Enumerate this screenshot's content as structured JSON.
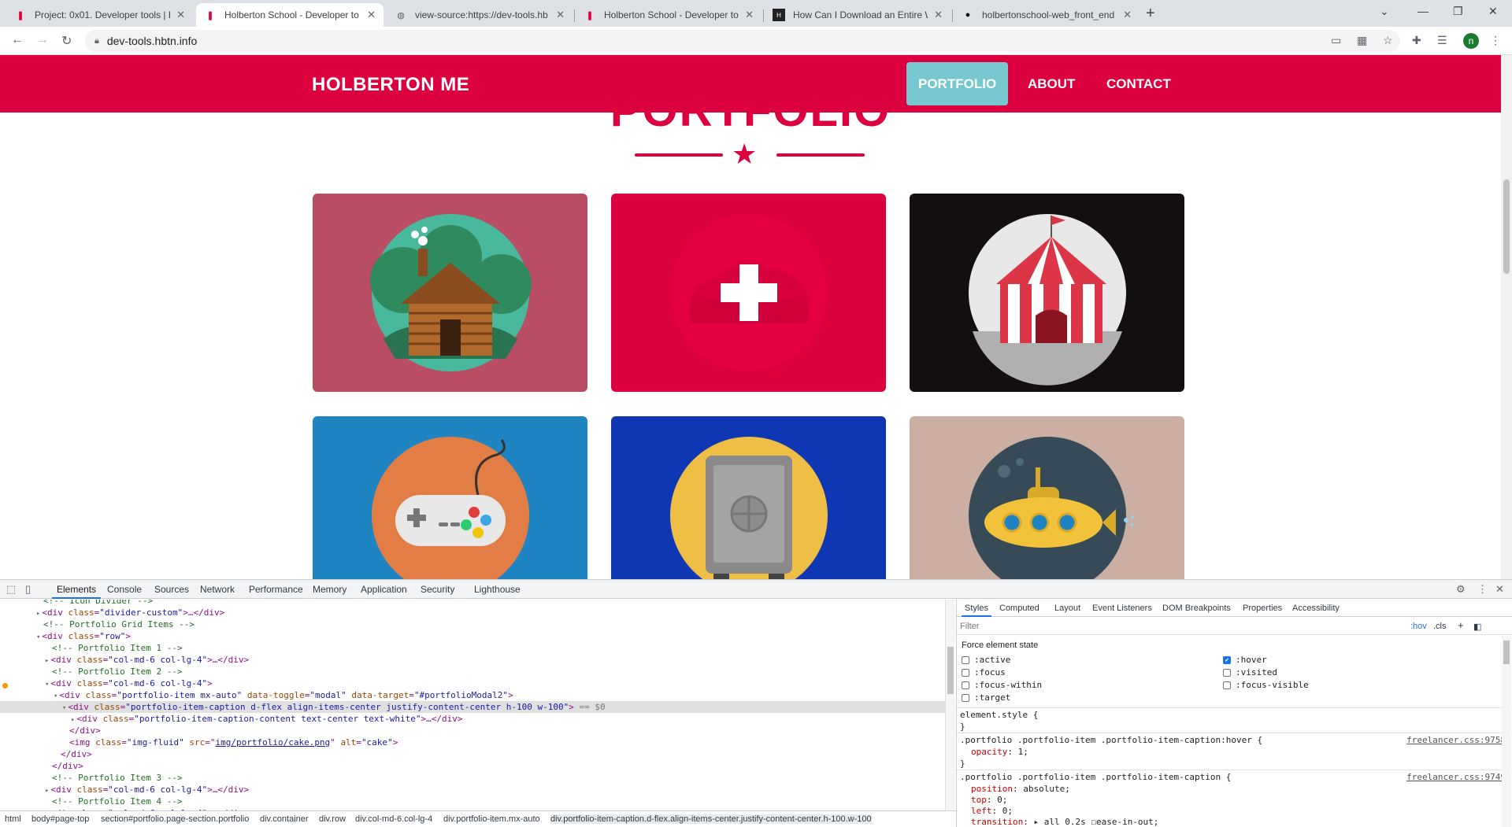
{
  "tabs": [
    {
      "title": "Project: 0x01. Developer tools | H",
      "favicon": "holberton-icon"
    },
    {
      "title": "Holberton School - Developer to",
      "favicon": "holberton-icon"
    },
    {
      "title": "view-source:https://dev-tools.hb",
      "favicon": "globe-icon"
    },
    {
      "title": "Holberton School - Developer to",
      "favicon": "holberton-icon"
    },
    {
      "title": "How Can I Download an Entire W",
      "favicon": "htg-icon"
    },
    {
      "title": "holbertonschool-web_front_end",
      "favicon": "github-icon"
    }
  ],
  "address": {
    "url": "dev-tools.hbtn.info"
  },
  "site": {
    "brand": "HOLBERTON ME",
    "nav": [
      "PORTFOLIO",
      "ABOUT",
      "CONTACT"
    ],
    "section_title": "PORTFOLIO",
    "portfolio_items": [
      {
        "name": "cabin",
        "bg": "#b84d63"
      },
      {
        "name": "cake",
        "bg": "#dc003f"
      },
      {
        "name": "circus",
        "bg": "#130f0f"
      },
      {
        "name": "game",
        "bg": "#1f84c2"
      },
      {
        "name": "safe",
        "bg": "#1037b3"
      },
      {
        "name": "submarine",
        "bg": "#ccaea3"
      }
    ]
  },
  "devtools": {
    "tabs": [
      "Elements",
      "Console",
      "Sources",
      "Network",
      "Performance",
      "Memory",
      "Application",
      "Security",
      "Lighthouse"
    ],
    "dom": {
      "l0": "<!-- Icon Divider -->",
      "l1_tag": "<div ",
      "l1_attr": "class",
      "l1_val": "\"divider-custom\"",
      "l1_end": ">…</div>",
      "l2": "<!-- Portfolio Grid Items -->",
      "l3_val": "\"row\"",
      "l4": "<!-- Portfolio Item 1 -->",
      "col_val": "\"col-md-6 col-lg-4\"",
      "l6": "<!-- Portfolio Item 2 -->",
      "l8_val": "\"portfolio-item mx-auto\"",
      "l8_a2": "data-toggle",
      "l8_v2": "\"modal\"",
      "l8_a3": "data-target",
      "l8_v3": "\"#portfolioModal2\"",
      "l9_val": "\"portfolio-item-caption d-flex align-items-center justify-content-center h-100 w-100\"",
      "l9_suffix": " == $0",
      "l10_val": "\"portfolio-item-caption-content text-center text-white\"",
      "close_div": "</div>",
      "img_cls": "\"img-fluid\"",
      "img_src": "img/portfolio/cake.png",
      "img_alt": "\"cake\"",
      "l15": "<!-- Portfolio Item 3 -->",
      "l17": "<!-- Portfolio Item 4 -->"
    },
    "breadcrumbs": [
      "html",
      "body#page-top",
      "section#portfolio.page-section.portfolio",
      "div.container",
      "div.row",
      "div.col-md-6.col-lg-4",
      "div.portfolio-item.mx-auto",
      "div.portfolio-item-caption.d-flex.align-items-center.justify-content-center.h-100.w-100"
    ],
    "styles": {
      "tabs": [
        "Styles",
        "Computed",
        "Layout",
        "Event Listeners",
        "DOM Breakpoints",
        "Properties",
        "Accessibility"
      ],
      "filter_placeholder": "Filter",
      "hov": ":hov",
      "cls": ".cls",
      "force_state_title": "Force element state",
      "states_left": [
        ":active",
        ":focus",
        ":focus-within",
        ":target"
      ],
      "states_right": [
        ":hover",
        ":visited",
        ":focus-visible"
      ],
      "checked_state": ":hover",
      "element_style": "element.style {",
      "close_brace": "}",
      "rule1_selector": ".portfolio .portfolio-item .portfolio-item-caption:hover {",
      "rule1_src": "freelancer.css:9758",
      "rule1_prop": "opacity",
      "rule1_val": "1;",
      "rule2_selector": ".portfolio .portfolio-item .portfolio-item-caption {",
      "rule2_src": "freelancer.css:9749",
      "rule2_props": [
        {
          "p": "position",
          "v": "absolute;"
        },
        {
          "p": "top",
          "v": "0;"
        },
        {
          "p": "left",
          "v": "0;"
        },
        {
          "p": "transition",
          "v": "▸ all 0.2s ☐ease-in-out;"
        }
      ]
    }
  }
}
